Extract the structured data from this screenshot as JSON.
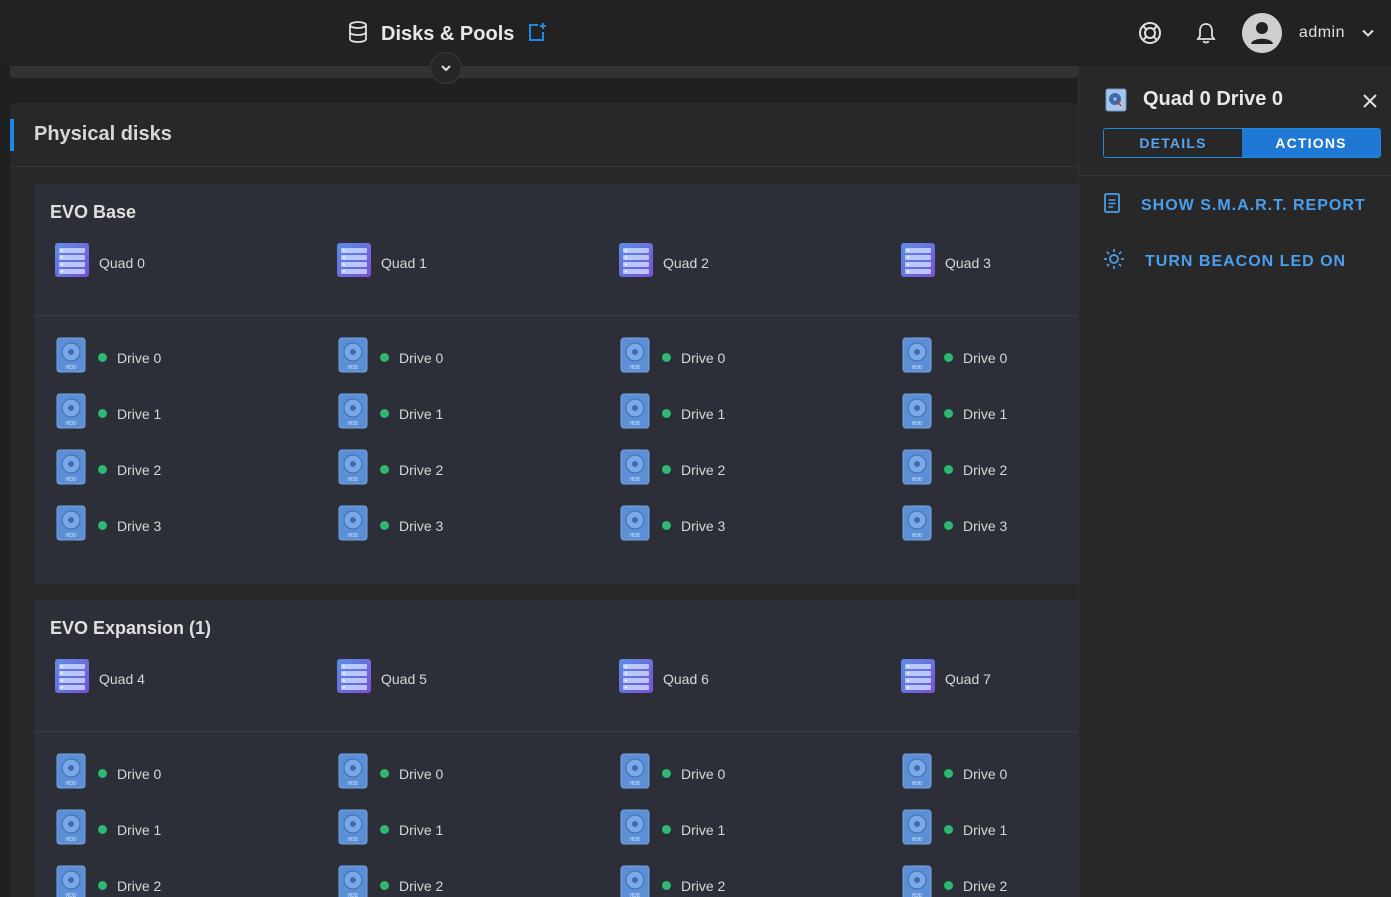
{
  "header": {
    "title": "Disks & Pools",
    "user": "admin"
  },
  "card": {
    "title": "Physical disks"
  },
  "enclosures": [
    {
      "name": "EVO Base",
      "quads": [
        "Quad 0",
        "Quad 1",
        "Quad 2",
        "Quad 3"
      ],
      "drives": [
        "Drive 0",
        "Drive 1",
        "Drive 2",
        "Drive 3"
      ]
    },
    {
      "name": "EVO Expansion (1)",
      "quads": [
        "Quad 4",
        "Quad 5",
        "Quad 6",
        "Quad 7"
      ],
      "drives": [
        "Drive 0",
        "Drive 1",
        "Drive 2"
      ]
    }
  ],
  "drive_icon_text": "HDD",
  "panel": {
    "title": "Quad 0 Drive 0",
    "tabs": [
      {
        "label": "DETAILS",
        "active": false
      },
      {
        "label": "ACTIONS",
        "active": true
      }
    ],
    "actions": [
      {
        "label": "SHOW S.M.A.R.T. REPORT",
        "icon": "report-icon"
      },
      {
        "label": "TURN BEACON LED ON",
        "icon": "beacon-icon"
      }
    ]
  },
  "colors": {
    "accent": "#1e88e5",
    "status_ok": "#2eb872",
    "link": "#4b9fef"
  }
}
